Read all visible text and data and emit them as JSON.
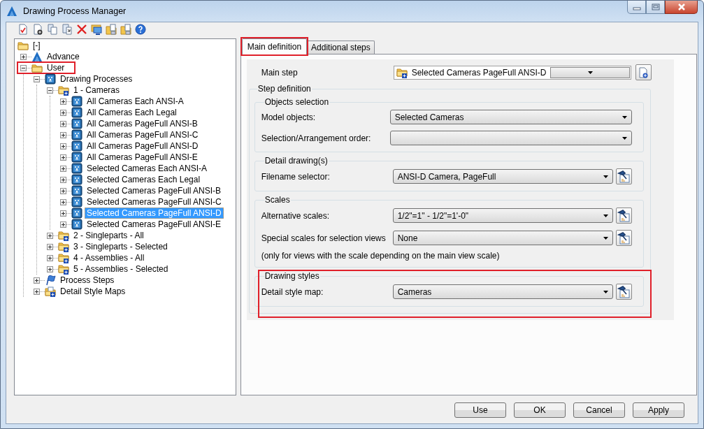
{
  "window": {
    "title": "Drawing Process Manager"
  },
  "tree": {
    "label": "[-]",
    "kind": "folder",
    "selected": false,
    "highlighted": false,
    "children": [
      {
        "label": "Advance",
        "kind": "app",
        "expanded": false,
        "selected": false,
        "highlighted": false
      },
      {
        "label": "User",
        "kind": "folder",
        "expanded": true,
        "selected": false,
        "highlighted": true,
        "children": [
          {
            "label": "Drawing Processes",
            "kind": "process",
            "expanded": true,
            "selected": false,
            "highlighted": false,
            "children": [
              {
                "label": "1 - Cameras",
                "kind": "process-folder",
                "expanded": true,
                "selected": false,
                "highlighted": false,
                "children": [
                  {
                    "label": "All Cameras Each ANSI-A",
                    "kind": "process",
                    "expanded": false,
                    "selected": false,
                    "highlighted": false
                  },
                  {
                    "label": "All Cameras Each Legal",
                    "kind": "process",
                    "expanded": false,
                    "selected": false,
                    "highlighted": false
                  },
                  {
                    "label": "All Cameras PageFull ANSI-B",
                    "kind": "process",
                    "expanded": false,
                    "selected": false,
                    "highlighted": false
                  },
                  {
                    "label": "All Cameras PageFull ANSI-C",
                    "kind": "process",
                    "expanded": false,
                    "selected": false,
                    "highlighted": false
                  },
                  {
                    "label": "All Cameras PageFull ANSI-D",
                    "kind": "process",
                    "expanded": false,
                    "selected": false,
                    "highlighted": false
                  },
                  {
                    "label": "All Cameras PageFull ANSI-E",
                    "kind": "process",
                    "expanded": false,
                    "selected": false,
                    "highlighted": false
                  },
                  {
                    "label": "Selected Cameras Each ANSI-A",
                    "kind": "process",
                    "expanded": false,
                    "selected": false,
                    "highlighted": false
                  },
                  {
                    "label": "Selected Cameras Each Legal",
                    "kind": "process",
                    "expanded": false,
                    "selected": false,
                    "highlighted": false
                  },
                  {
                    "label": "Selected Cameras PageFull ANSI-B",
                    "kind": "process",
                    "expanded": false,
                    "selected": false,
                    "highlighted": false
                  },
                  {
                    "label": "Selected Cameras PageFull ANSI-C",
                    "kind": "process",
                    "expanded": false,
                    "selected": false,
                    "highlighted": false
                  },
                  {
                    "label": "Selected Cameras PageFull ANSI-D",
                    "kind": "process",
                    "expanded": false,
                    "selected": true,
                    "highlighted": false
                  },
                  {
                    "label": "Selected Cameras PageFull ANSI-E",
                    "kind": "process",
                    "expanded": false,
                    "selected": false,
                    "highlighted": false
                  }
                ]
              },
              {
                "label": "2 - Singleparts - All",
                "kind": "process-folder",
                "expanded": false,
                "selected": false,
                "highlighted": false
              },
              {
                "label": "3 - Singleparts - Selected",
                "kind": "process-folder",
                "expanded": false,
                "selected": false,
                "highlighted": false
              },
              {
                "label": "4 - Assemblies - All",
                "kind": "process-folder",
                "expanded": false,
                "selected": false,
                "highlighted": false
              },
              {
                "label": "5 - Assemblies - Selected",
                "kind": "process-folder",
                "expanded": false,
                "selected": false,
                "highlighted": false
              }
            ]
          },
          {
            "label": "Process Steps",
            "kind": "flag",
            "expanded": false,
            "selected": false,
            "highlighted": false
          },
          {
            "label": "Detail Style Maps",
            "kind": "style-map",
            "expanded": false,
            "selected": false,
            "highlighted": false
          }
        ]
      }
    ]
  },
  "tabs": [
    {
      "label": "Main definition",
      "selected": true,
      "highlighted": true
    },
    {
      "label": "Additional steps",
      "selected": false,
      "highlighted": false
    }
  ],
  "main_step": {
    "label": "Main step",
    "value": "Selected Cameras PageFull ANSI-D"
  },
  "step_definition": {
    "title": "Step definition",
    "groups": [
      {
        "title": "Objects selection",
        "highlighted": false,
        "rows": [
          {
            "label": "Model objects:",
            "value": "Selected Cameras",
            "edit_button": false
          },
          {
            "label": "Selection/Arrangement order:",
            "edit_button": false
          }
        ]
      },
      {
        "title": "Detail drawing(s)",
        "highlighted": false,
        "rows": [
          {
            "label": "Filename selector:",
            "value": "ANSI-D Camera, PageFull",
            "edit_button": true
          }
        ]
      },
      {
        "title": "Scales",
        "highlighted": false,
        "rows": [
          {
            "label": "Alternative scales:",
            "value": "1/2\"=1\" - 1/2\"=1'-0\"",
            "edit_button": true
          },
          {
            "label": "Special scales for selection views",
            "value": "None",
            "edit_button": true
          }
        ],
        "note": "(only for views with the scale depending on the main view scale)"
      },
      {
        "title": "Drawing styles",
        "highlighted": true,
        "rows": [
          {
            "label": "Detail style map:",
            "value": "Cameras",
            "edit_button": true
          }
        ]
      }
    ]
  },
  "buttons": [
    "Use",
    "OK",
    "Cancel",
    "Apply"
  ]
}
